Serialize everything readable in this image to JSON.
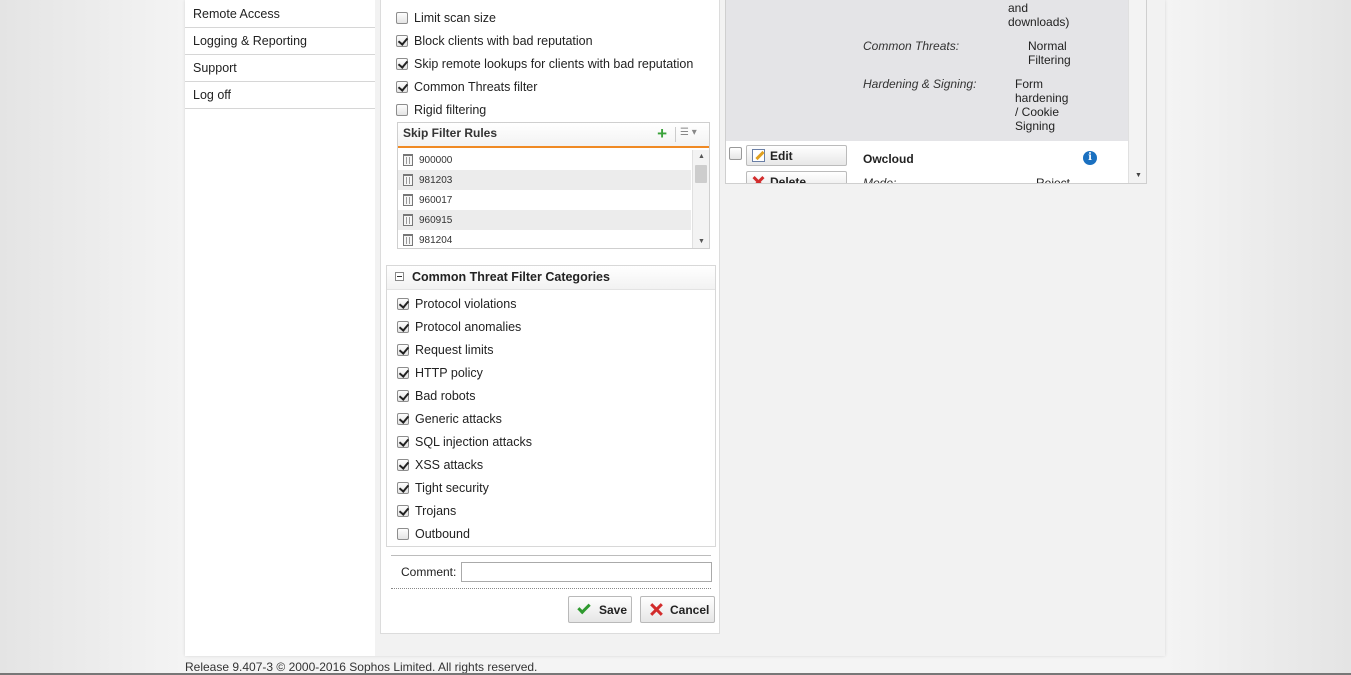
{
  "nav": {
    "items": [
      "Remote Access",
      "Logging & Reporting",
      "Support",
      "Log off"
    ]
  },
  "options": [
    {
      "label": "Limit scan size",
      "checked": false
    },
    {
      "label": "Block clients with bad reputation",
      "checked": true
    },
    {
      "label": "Skip remote lookups for clients with bad reputation",
      "checked": true
    },
    {
      "label": "Common Threats filter",
      "checked": true
    },
    {
      "label": "Rigid filtering",
      "checked": false
    }
  ],
  "skip_rules": {
    "title": "Skip Filter Rules",
    "add_icon": "plus-icon",
    "menu_icon": "list-menu-icon",
    "items": [
      "900000",
      "981203",
      "960017",
      "960915",
      "981204"
    ]
  },
  "categories": {
    "title": "Common Threat Filter Categories",
    "items": [
      {
        "label": "Protocol violations",
        "checked": true
      },
      {
        "label": "Protocol anomalies",
        "checked": true
      },
      {
        "label": "Request limits",
        "checked": true
      },
      {
        "label": "HTTP policy",
        "checked": true
      },
      {
        "label": "Bad robots",
        "checked": true
      },
      {
        "label": "Generic attacks",
        "checked": true
      },
      {
        "label": "SQL injection attacks",
        "checked": true
      },
      {
        "label": "XSS attacks",
        "checked": true
      },
      {
        "label": "Tight security",
        "checked": true
      },
      {
        "label": "Trojans",
        "checked": true
      },
      {
        "label": "Outbound",
        "checked": false
      }
    ]
  },
  "comment": {
    "label": "Comment:",
    "value": ""
  },
  "buttons": {
    "save": "Save",
    "cancel": "Cancel"
  },
  "right_panel": {
    "prev_line1": "and",
    "prev_line2": "downloads)",
    "common_threats_label": "Common Threats:",
    "common_threats_value_1": "Normal",
    "common_threats_value_2": "Filtering",
    "hardening_label": "Hardening & Signing:",
    "hardening_value_1": "Form",
    "hardening_value_2": "hardening",
    "hardening_value_3": "/ Cookie",
    "hardening_value_4": "Signing",
    "edit": "Edit",
    "delete": "Delete",
    "profile_name": "Owcloud",
    "mode_label": "Mode:",
    "mode_value": "Reject"
  },
  "footer": "Release 9.407-3  © 2000-2016 Sophos Limited. All rights reserved.",
  "colors": {
    "accent": "#f08a24",
    "add": "#3aa23a",
    "cancel": "#d22c2c",
    "info": "#1a70c0"
  }
}
